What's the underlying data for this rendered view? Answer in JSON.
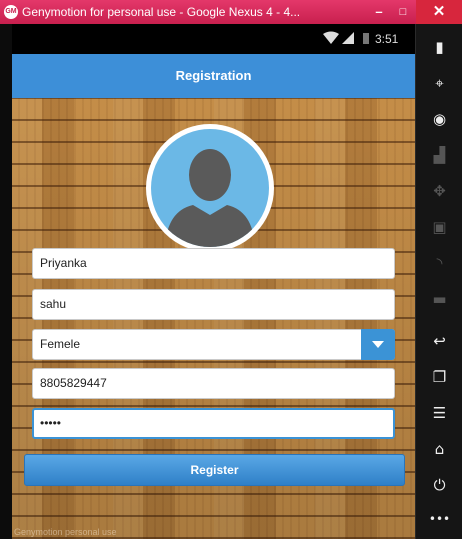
{
  "window": {
    "logo": "GM",
    "title": "Genymotion for personal use - Google Nexus 4 - 4...",
    "minimize": "–",
    "maximize": "□",
    "close": "✕"
  },
  "status_bar": {
    "signal_icon": "wifi-signal-icon",
    "time": "3:51"
  },
  "action_bar": {
    "title": "Registration"
  },
  "form": {
    "avatar_icon": "user-silhouette-icon",
    "first_name": "Priyanka",
    "last_name": "sahu",
    "gender_selected": "Femele",
    "phone": "8805829447",
    "password_masked": "•••••",
    "register_label": "Register"
  },
  "watermark": "Genymotion personal use",
  "side_panel": [
    {
      "icon": "battery-icon",
      "glyph": "▮"
    },
    {
      "icon": "gps-icon",
      "glyph": "⌖"
    },
    {
      "icon": "camera-icon",
      "glyph": "◉"
    },
    {
      "icon": "phone-signal-icon",
      "glyph": "▟"
    },
    {
      "icon": "dpad-icon",
      "glyph": "✥"
    },
    {
      "icon": "id-icon",
      "glyph": "▣"
    },
    {
      "icon": "rss-icon",
      "glyph": "◝"
    },
    {
      "icon": "sms-icon",
      "glyph": "▬"
    },
    {
      "icon": "back-icon",
      "glyph": "↩"
    },
    {
      "icon": "recent-apps-icon",
      "glyph": "❐"
    },
    {
      "icon": "menu-icon",
      "glyph": "☰"
    },
    {
      "icon": "home-icon",
      "glyph": "⌂"
    },
    {
      "icon": "power-icon",
      "glyph": "⏻"
    },
    {
      "icon": "more-icon",
      "glyph": "•••"
    }
  ],
  "colors": {
    "accent": "#3b93d6",
    "title_bar": "#c8204e",
    "wood": "#c98f47"
  }
}
